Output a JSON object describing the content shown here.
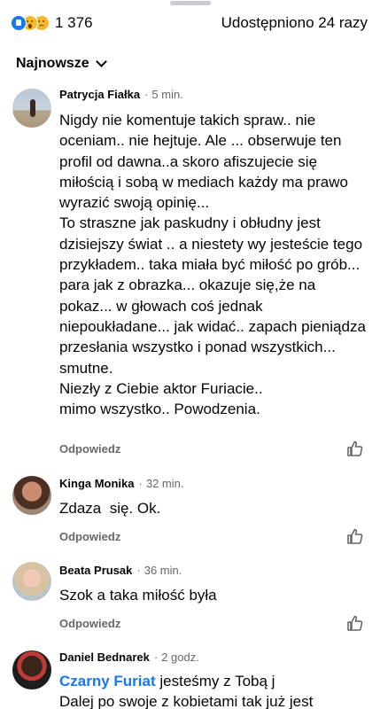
{
  "header": {
    "reactions": [
      "like-reaction-icon",
      "wow-reaction-icon",
      "sad-reaction-icon"
    ],
    "reaction_count": "1 376",
    "shares": "Udostępniono 24 razy"
  },
  "sort": {
    "label": "Najnowsze"
  },
  "comments": [
    {
      "author": "Patrycja Fiałka",
      "time": "5 min.",
      "text": "Nigdy nie komentuje takich spraw.. nie oceniam.. nie hejtuje. Ale ... obserwuje ten profil od dawna..a skoro afiszujecie się miłością i sobą w mediach każdy ma prawo wyrazić swoją opinię...\nTo straszne jak paskudny i obłudny jest dzisiejszy świat .. a niestety wy jesteście tego przykładem.. taka miała być miłość po grób... para jak z obrazka... okazuje się,że na pokaz... w głowach coś jednak niepoukładane... jak widać.. zapach pieniądza przesłania wszystko i ponad wszystkich... smutne.\nNiezły z Ciebie aktor Furiacie..\nmimo wszystko.. Powodzenia.",
      "reply": "Odpowiedz"
    },
    {
      "author": "Kinga Monika",
      "time": "32 min.",
      "text": "Zdaza  się. Ok.",
      "reply": "Odpowiedz"
    },
    {
      "author": "Beata Prusak",
      "time": "36 min.",
      "text": "Szok a taka miłość była",
      "reply": "Odpowiedz"
    },
    {
      "author": "Daniel Bednarek",
      "time": "2 godz.",
      "mention": "Czarny Furiat",
      "text": " jesteśmy z Tobą j\nDalej po swoje z kobietami tak już jest"
    }
  ],
  "colors": {
    "accent": "#1877f2",
    "meta_text": "#65676b"
  }
}
